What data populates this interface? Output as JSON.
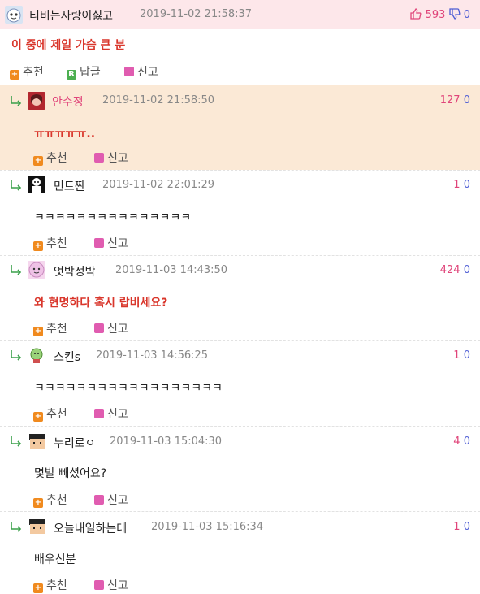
{
  "main": {
    "nickname": "티비는사랑이싫고",
    "date": "2019-11-02 21:58:37",
    "upvotes": "593",
    "downvotes": "0",
    "text": "이 중에 제일 가슴 큰 분",
    "actions": {
      "recommend": "추천",
      "reply": "답글",
      "report": "신고"
    }
  },
  "replies": [
    {
      "nickname": "안수정",
      "date": "2019-11-02 21:58:50",
      "upvotes": "127",
      "downvotes": "0",
      "text": "ㅠㅠㅠㅠㅠ..",
      "recommend": "추천",
      "report": "신고"
    },
    {
      "nickname": "민트짠",
      "date": "2019-11-02 22:01:29",
      "upvotes": "1",
      "downvotes": "0",
      "text": "ㅋㅋㅋㅋㅋㅋㅋㅋㅋㅋㅋㅋㅋㅋㅋ",
      "recommend": "추천",
      "report": "신고"
    },
    {
      "nickname": "엇박정박",
      "date": "2019-11-03 14:43:50",
      "upvotes": "424",
      "downvotes": "0",
      "text": "와 현명하다 혹시 랍비세요?",
      "recommend": "추천",
      "report": "신고"
    },
    {
      "nickname": "스킨s",
      "date": "2019-11-03 14:56:25",
      "upvotes": "1",
      "downvotes": "0",
      "text": "ㅋㅋㅋㅋㅋㅋㅋㅋㅋㅋㅋㅋㅋㅋㅋㅋㅋㅋ",
      "recommend": "추천",
      "report": "신고"
    },
    {
      "nickname": "누리로ㅇ",
      "date": "2019-11-03 15:04:30",
      "upvotes": "4",
      "downvotes": "0",
      "text": "몇발 빼셨어요?",
      "recommend": "추천",
      "report": "신고"
    },
    {
      "nickname": "오늘내일하는데",
      "date": "2019-11-03 15:16:34",
      "upvotes": "1",
      "downvotes": "0",
      "text": "배우신분",
      "recommend": "추천",
      "report": "신고"
    }
  ],
  "colors": {
    "upvote": "#e0457a",
    "downvote": "#4c5bd4",
    "highlight": "#fbe9d6",
    "header": "#fde7ea",
    "best_text": "#d9362b"
  }
}
